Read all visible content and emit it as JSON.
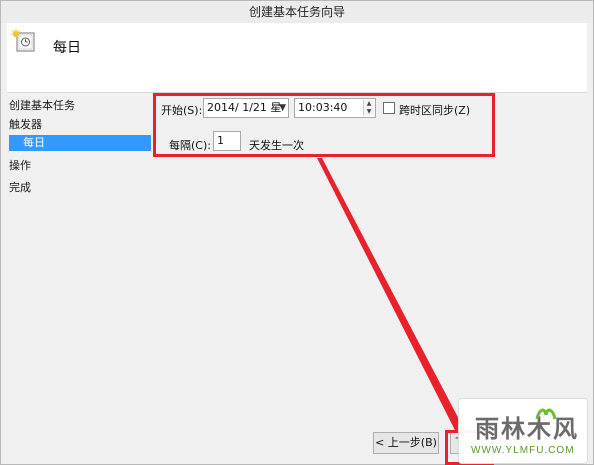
{
  "window": {
    "title": "创建基本任务向导"
  },
  "header": {
    "title": "每日",
    "icon": "task-clock-icon"
  },
  "nav": {
    "items": [
      {
        "label": "创建基本任务"
      },
      {
        "label": "触发器"
      },
      {
        "label": "每日",
        "selected": true
      },
      {
        "label": "操作"
      },
      {
        "label": "完成"
      }
    ]
  },
  "form": {
    "start_label": "开始(S):",
    "start_date": "2014/  1/21 星",
    "start_time": "10:03:40",
    "sync_label": "跨时区同步(Z)",
    "sync_checked": false,
    "recur_label": "每隔(C):",
    "recur_value": "1",
    "recur_suffix": "天发生一次"
  },
  "buttons": {
    "back": "< 上一步(B)",
    "next": "下"
  },
  "watermark": {
    "text": "雨林木风",
    "url": "WWW.YLMFU.COM"
  },
  "colors": {
    "highlight": "#e8222c",
    "selection": "#3399ff"
  }
}
